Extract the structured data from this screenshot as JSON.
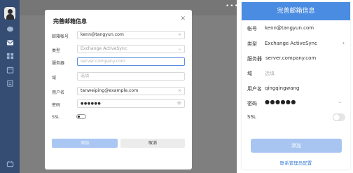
{
  "desktop": {
    "more_icon": "more-dots-icon",
    "sidebar_icons": [
      "avatar",
      "chat-icon",
      "mail-icon",
      "grid-icon",
      "calendar-icon",
      "tasks-icon",
      "settings-icon"
    ],
    "dialog": {
      "title": "完善邮箱信息",
      "close_icon": "close-icon",
      "fields": {
        "account": {
          "label": "邮箱帐号",
          "value": "kenn@tangyun.com",
          "suffix": "×"
        },
        "type": {
          "label": "类型",
          "value": "Exchange ActiveSync",
          "suffix": "⌄"
        },
        "server": {
          "label": "服务器",
          "placeholder": "server.company.com"
        },
        "domain": {
          "label": "域",
          "placeholder": "选填"
        },
        "username": {
          "label": "用户名",
          "value": "tanweiping@example.com",
          "suffix": "×"
        },
        "password": {
          "label": "密码",
          "value": "●●●●●●",
          "suffix": "👁"
        },
        "ssl": {
          "label": "SSL",
          "enabled": false
        }
      },
      "add_label": "添加",
      "cancel_label": "取消"
    }
  },
  "mobile": {
    "title": "完善邮箱信息",
    "account": {
      "label": "帐号",
      "value": "kenn@tangyun.com"
    },
    "type": {
      "label": "类型",
      "value": "Exchange ActiveSync",
      "chevron": "›"
    },
    "server": {
      "label": "服务器",
      "value": "server.company.com"
    },
    "domain": {
      "label": "域",
      "placeholder": "选填"
    },
    "username": {
      "label": "用户名",
      "value": "qingqingwang"
    },
    "password": {
      "label": "密码",
      "value": "●●●●●●",
      "eye": "⌣"
    },
    "ssl": {
      "label": "SSL",
      "enabled": false
    },
    "add_label": "添加",
    "admin_link": "联系管理员配置"
  },
  "colors": {
    "sidebar": "#354d73",
    "primary": "#4a8ce2",
    "button_disabled": "#a8c5f2",
    "backdrop": "#7f7f7f"
  }
}
